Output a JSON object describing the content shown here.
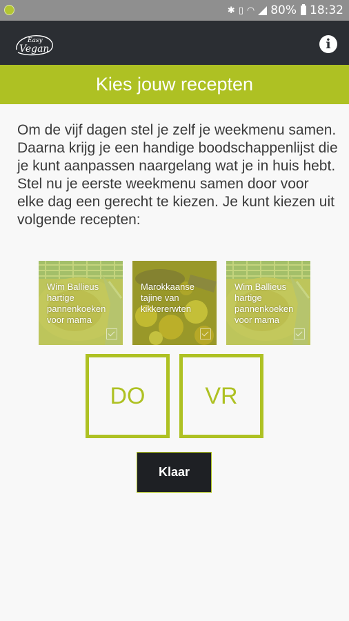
{
  "status_bar": {
    "battery_percent": "80%",
    "time": "18:32",
    "icons": [
      "easy-vegan-notification-icon",
      "bluetooth-icon",
      "vibrate-icon",
      "wifi-icon",
      "signal-icon",
      "battery-icon"
    ]
  },
  "app_bar": {
    "logo_text_top": "Easy",
    "logo_text_bottom": "Vegan",
    "info_icon_label": "i"
  },
  "header": {
    "title": "Kies jouw recepten"
  },
  "intro": "Om de vijf dagen stel je zelf je weekmenu samen. Daarna krijg je een handige boodschappenlijst die je kunt aanpassen naargelang wat je in huis hebt. Stel nu je eerste weekmenu samen door voor elke dag een gerecht te kiezen. Je kunt kiezen uit volgende recepten:",
  "recipes": [
    {
      "title": "Wim Ballieus hartige pannenkoeken voor mama"
    },
    {
      "title": "Marokkaanse tajine van kikkererwten"
    },
    {
      "title": "Wim Ballieus hartige pannenkoeken voor mama"
    }
  ],
  "days": [
    "DO",
    "VR"
  ],
  "done_button": "Klaar",
  "colors": {
    "accent": "#aec123",
    "app_bar": "#2b2e33",
    "status_bar": "#8f8f8f",
    "button": "#1e2024",
    "background": "#f8f8f8"
  }
}
